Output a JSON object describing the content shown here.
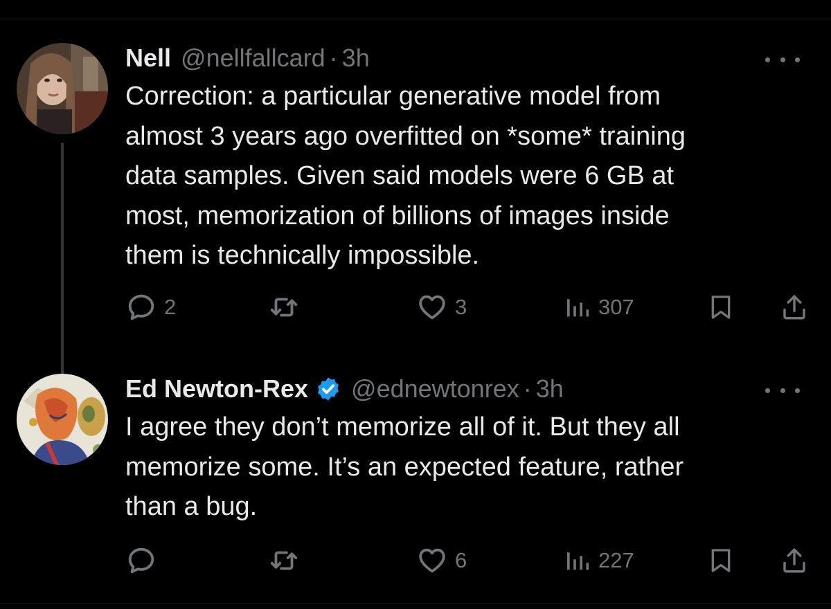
{
  "tweets": [
    {
      "name": "Nell",
      "handle": "@nellfallcard",
      "separator": "·",
      "time": "3h",
      "verified": false,
      "text": "Correction: a particular generative model from\nalmost 3 years ago overfitted on *some* training\ndata samples. Given said models were 6 GB at\nmost, memorization of billions of images inside\nthem is technically impossible.",
      "replies": "2",
      "retweets": "",
      "likes": "3",
      "views": "307",
      "icons": [
        "reply-icon",
        "retweet-icon",
        "like-icon",
        "views-icon",
        "bookmark-icon",
        "share-icon"
      ]
    },
    {
      "name": "Ed Newton-Rex",
      "handle": "@ednewtonrex",
      "separator": "·",
      "time": "3h",
      "verified": true,
      "text": "I agree they don’t memorize all of it. But they all\nmemorize some. It’s an expected feature, rather\nthan a bug.",
      "replies": "",
      "retweets": "",
      "likes": "6",
      "views": "227",
      "icons": [
        "reply-icon",
        "retweet-icon",
        "like-icon",
        "views-icon",
        "bookmark-icon",
        "share-icon"
      ]
    }
  ],
  "colors": {
    "background": "#000000",
    "text": "#e7e9ea",
    "muted": "#71767b",
    "verified": "#1d9bf0",
    "thread_line": "#333639"
  }
}
